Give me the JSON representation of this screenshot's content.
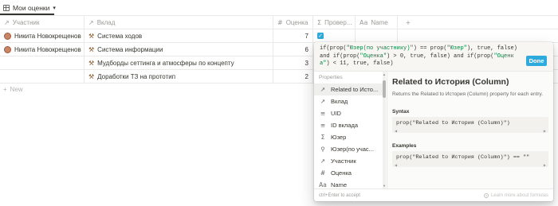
{
  "view": {
    "name": "Мои оценки"
  },
  "table": {
    "headers": {
      "participant": "Участник",
      "contribution": "Вклад",
      "rating": "Оценка",
      "check": "Провер...",
      "name": "Name",
      "add": "+"
    },
    "rows": [
      {
        "participant": "Никита Новокрещенов",
        "has_avatar": true,
        "contribution": "Система ходов",
        "rating": "7",
        "checked": true
      },
      {
        "participant": "Никита Новокрещенов",
        "has_avatar": true,
        "contribution": "Система информации",
        "rating": "6",
        "checked": false
      },
      {
        "participant": "",
        "has_avatar": false,
        "contribution": "Мудборды сеттинга и атмосферы по концепту",
        "rating": "3",
        "checked": false
      },
      {
        "participant": "",
        "has_avatar": false,
        "contribution": "Доработки ТЗ на прототип",
        "rating": "2",
        "checked": false
      }
    ],
    "new_row_label": "New"
  },
  "formula": {
    "expression": "if(prop(\"Юзер(по участнику)\") == prop(\"Юзер\"), true, false) and if(prop(\"Оценка\") > 0, true, false) and if(prop(\"Оценка\") < 11, true, false)",
    "done_label": "Done"
  },
  "properties": {
    "heading": "Properties",
    "items": [
      {
        "label": "Related to Исто...",
        "icon": "relation-arrow-icon",
        "glyph": "↗",
        "active": true
      },
      {
        "label": "Вклад",
        "icon": "relation-arrow-icon",
        "glyph": "↗",
        "active": false
      },
      {
        "label": "UID",
        "icon": "text-lines-icon",
        "glyph": "≡",
        "active": false
      },
      {
        "label": "ID вклада",
        "icon": "text-lines-icon",
        "glyph": "≡",
        "active": false
      },
      {
        "label": "Юзер",
        "icon": "formula-sigma-icon",
        "glyph": "Σ",
        "active": false
      },
      {
        "label": "Юзер(по учас...",
        "icon": "rollup-search-icon",
        "glyph": "⚲",
        "active": false
      },
      {
        "label": "Участник",
        "icon": "relation-arrow-icon",
        "glyph": "↗",
        "active": false
      },
      {
        "label": "Оценка",
        "icon": "number-hash-icon",
        "glyph": "#",
        "active": false
      },
      {
        "label": "Name",
        "icon": "text-aa-icon",
        "glyph": "Aa",
        "active": false
      }
    ]
  },
  "help": {
    "title": "Related to История (Column)",
    "description": "Returns the Related to История (Column) property for each entry.",
    "syntax_label": "Syntax",
    "syntax_code": "prop(\"Related to История (Column)\")",
    "examples_label": "Examples",
    "example_code": "prop(\"Related to История (Column)\") == \"\""
  },
  "footer": {
    "hint": "ctrl+Enter to accept",
    "learn_more": "Learn more about formulas"
  }
}
